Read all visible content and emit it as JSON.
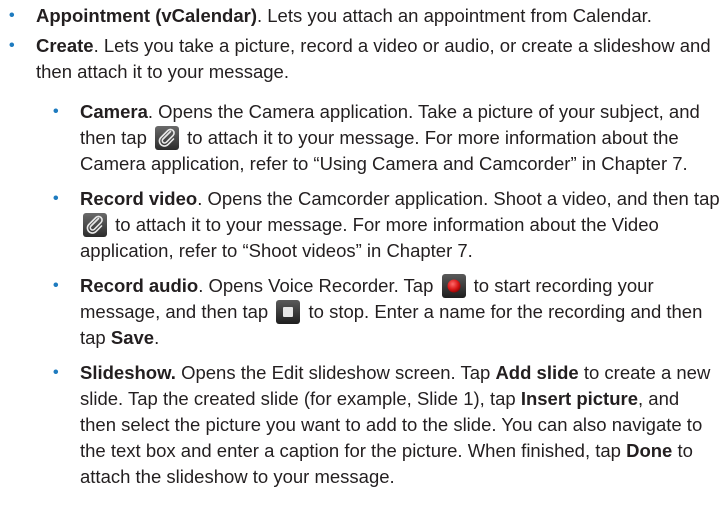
{
  "colors": {
    "bullet": "#1e7bbf",
    "text": "#231f20"
  },
  "bullet_glyph": "•",
  "items": [
    {
      "title": "Appointment (vCalendar)",
      "text": ". Lets you attach an appointment from Calendar."
    },
    {
      "title": "Create",
      "text": ". Lets you take a picture, record a video or audio, or create a slideshow and then attach it to your message."
    }
  ],
  "subitems": {
    "camera": {
      "title": "Camera",
      "text_before_icon": ". Opens the Camera application. Take a picture of your subject, and then tap ",
      "icon": "paperclip-icon",
      "text_after_icon": " to attach it to your message. For more information about the Camera application, refer to “Using Camera and Camcorder” in Chapter 7."
    },
    "record_video": {
      "title": "Record video",
      "text_before_icon": ". Opens the Camcorder application. Shoot a video, and then tap ",
      "icon": "paperclip-icon",
      "text_after_icon": " to attach it to your message. For more information about the Video application, refer to “Shoot videos” in Chapter 7."
    },
    "record_audio": {
      "title": "Record audio",
      "text_1": ". Opens Voice Recorder. Tap ",
      "icon_record": "record-icon",
      "text_2": " to start recording your message, and then tap ",
      "icon_stop": "stop-icon",
      "text_3": " to stop. Enter a name for the recording and then tap ",
      "bold_save": "Save",
      "text_4": "."
    },
    "slideshow": {
      "title": "Slideshow.",
      "text_1": " Opens the Edit slideshow screen. Tap ",
      "bold_add_slide": "Add slide",
      "text_2": " to create a new slide. Tap the created slide (for example, Slide 1), tap ",
      "bold_insert_picture": "Insert picture",
      "text_3": ", and then select the picture you want to add to the slide. You can also navigate to the text box and enter a caption for the picture. When finished, tap ",
      "bold_done": "Done",
      "text_4": " to attach the slideshow to your message."
    }
  }
}
